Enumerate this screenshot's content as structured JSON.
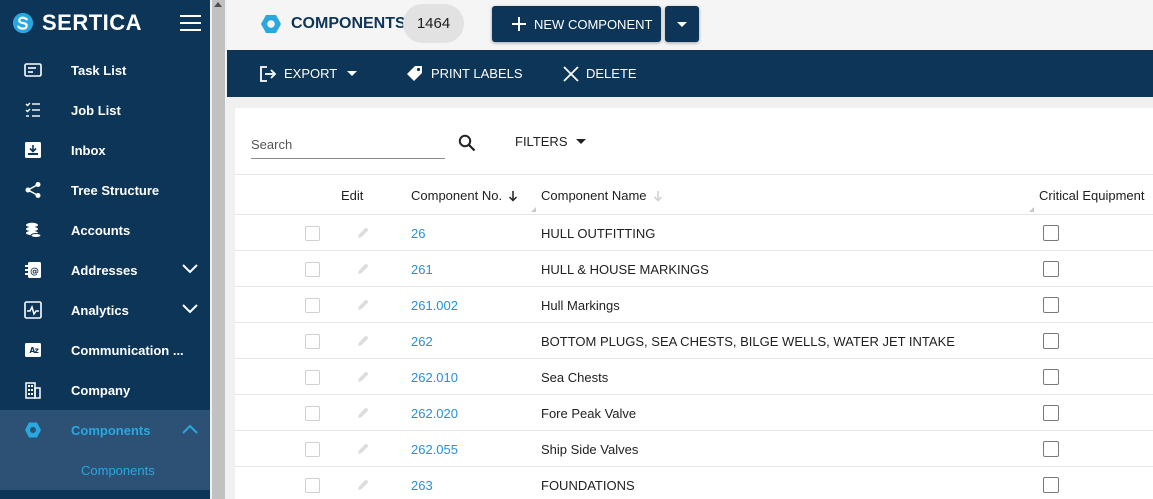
{
  "brand": {
    "name": "SERTICA"
  },
  "sidebar": {
    "items": [
      {
        "label": "Task List",
        "icon": "task-list-icon"
      },
      {
        "label": "Job List",
        "icon": "job-list-icon"
      },
      {
        "label": "Inbox",
        "icon": "inbox-icon"
      },
      {
        "label": "Tree Structure",
        "icon": "tree-structure-icon"
      },
      {
        "label": "Accounts",
        "icon": "accounts-icon"
      },
      {
        "label": "Addresses",
        "icon": "addresses-icon",
        "expandable": true
      },
      {
        "label": "Analytics",
        "icon": "analytics-icon",
        "expandable": true
      },
      {
        "label": "Communication ...",
        "icon": "communication-icon"
      },
      {
        "label": "Company",
        "icon": "company-icon"
      },
      {
        "label": "Components",
        "icon": "components-icon",
        "expanded": true,
        "active": true
      }
    ],
    "subitems": [
      {
        "label": "Components"
      }
    ]
  },
  "header": {
    "title": "COMPONENTS",
    "count": "1464",
    "new_button": "NEW COMPONENT"
  },
  "toolbar": {
    "export": "EXPORT",
    "print_labels": "PRINT LABELS",
    "delete": "DELETE"
  },
  "search": {
    "placeholder": "Search",
    "value": ""
  },
  "filters": {
    "label": "FILTERS"
  },
  "table": {
    "columns": {
      "edit": "Edit",
      "component_no": "Component No.",
      "component_name": "Component Name",
      "critical_equipment": "Critical Equipment"
    },
    "sort": {
      "column": "component_no",
      "direction": "descending-arrow"
    },
    "rows": [
      {
        "no": "26",
        "name": "HULL OUTFITTING",
        "critical": false
      },
      {
        "no": "261",
        "name": "HULL & HOUSE MARKINGS",
        "critical": false
      },
      {
        "no": "261.002",
        "name": "Hull Markings",
        "critical": false
      },
      {
        "no": "262",
        "name": "BOTTOM PLUGS, SEA CHESTS, BILGE WELLS, WATER JET INTAKE",
        "critical": false
      },
      {
        "no": "262.010",
        "name": "Sea Chests",
        "critical": false
      },
      {
        "no": "262.020",
        "name": "Fore Peak Valve",
        "critical": false
      },
      {
        "no": "262.055",
        "name": "Ship Side Valves",
        "critical": false
      },
      {
        "no": "263",
        "name": "FOUNDATIONS",
        "critical": false
      }
    ]
  },
  "colors": {
    "navy": "#0c3558",
    "active_bg": "#2c5175",
    "accent": "#29a8e0",
    "link": "#2a8fd6"
  }
}
